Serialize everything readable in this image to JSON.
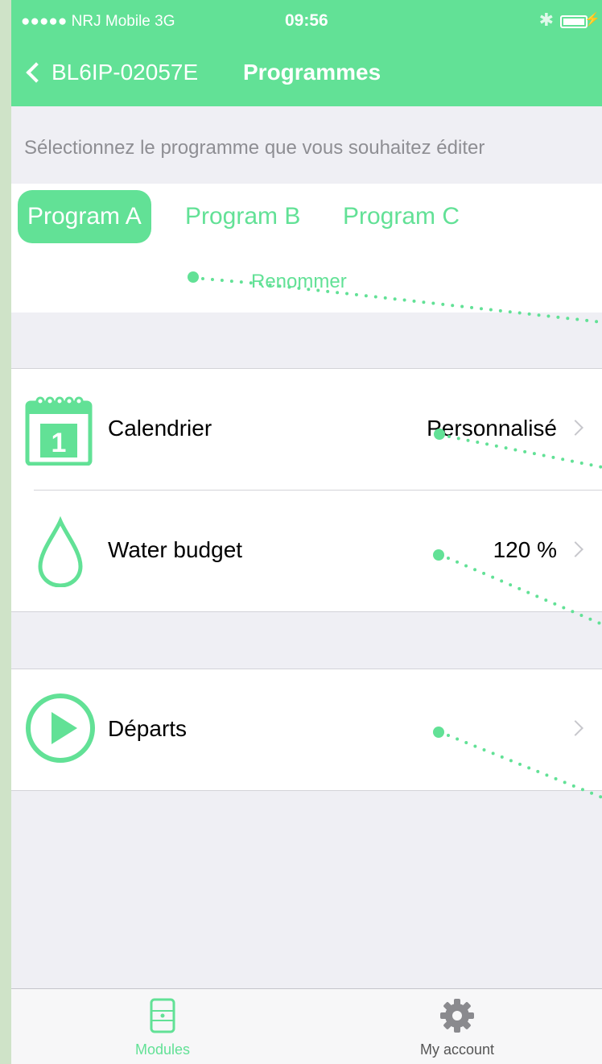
{
  "status_bar": {
    "carrier": "●●●●● NRJ Mobile  3G",
    "time": "09:56",
    "bluetooth_icon": "bluetooth-icon",
    "battery_icon": "battery-icon"
  },
  "nav": {
    "back_label": "BL6IP-02057E",
    "title": "Programmes"
  },
  "instruction": "Sélectionnez le programme que vous souhaitez éditer",
  "programs": [
    {
      "label": "Program A",
      "active": true
    },
    {
      "label": "Program B",
      "active": false
    },
    {
      "label": "Program C",
      "active": false
    }
  ],
  "rename_label": "Renommer",
  "settings": {
    "calendar": {
      "label": "Calendrier",
      "value": "Personnalisé",
      "icon": "calendar-icon",
      "icon_number": "1"
    },
    "water_budget": {
      "label": "Water budget",
      "value": "120 %",
      "icon": "water-drop-icon"
    },
    "departures": {
      "label": "Départs",
      "icon": "play-icon"
    }
  },
  "tabbar": {
    "modules": {
      "label": "Modules",
      "icon": "module-icon"
    },
    "account": {
      "label": "My account",
      "icon": "gear-icon"
    }
  },
  "colors": {
    "accent": "#62e196",
    "background": "#efeff4",
    "separator": "#d3d3d8"
  }
}
